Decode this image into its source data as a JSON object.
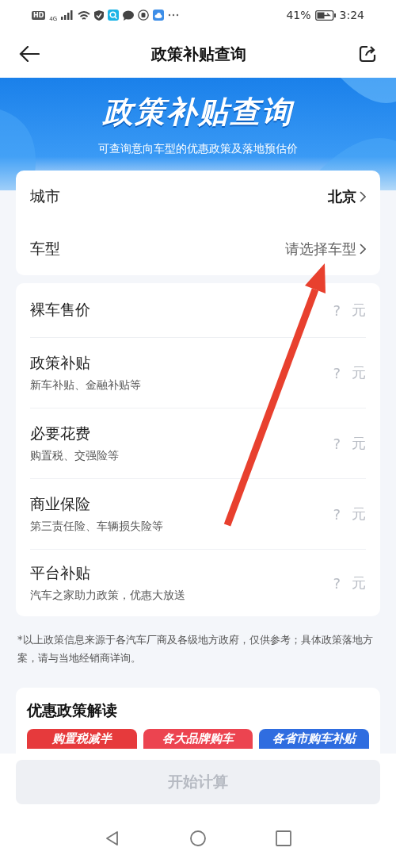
{
  "status_bar": {
    "badges": [
      "HD",
      "4G"
    ],
    "battery": "41%",
    "time": "3:24"
  },
  "nav": {
    "title": "政策补贴查询"
  },
  "banner": {
    "title": "政策补贴查询",
    "subtitle": "可查询意向车型的优惠政策及落地预估价"
  },
  "selectors": [
    {
      "label": "城市",
      "value": "北京",
      "kind": "value"
    },
    {
      "label": "车型",
      "value": "请选择车型",
      "kind": "placeholder"
    }
  ],
  "costs": [
    {
      "name": "裸车售价",
      "amount": "?",
      "unit": "元"
    },
    {
      "name": "政策补贴",
      "note": "新车补贴、金融补贴等",
      "amount": "?",
      "unit": "元"
    },
    {
      "name": "必要花费",
      "note": "购置税、交强险等",
      "amount": "?",
      "unit": "元"
    },
    {
      "name": "商业保险",
      "note": "第三责任险、车辆损失险等",
      "amount": "?",
      "unit": "元"
    },
    {
      "name": "平台补贴",
      "note": "汽车之家助力政策，优惠大放送",
      "amount": "?",
      "unit": "元"
    }
  ],
  "disclaimer": "*以上政策信息来源于各汽车厂商及各级地方政府，仅供参考；具体政策落地方案，请与当地经销商详询。",
  "policy_section": {
    "title": "优惠政策解读",
    "cards": [
      {
        "label": "购置税减半",
        "color": "#e63a3c"
      },
      {
        "label": "各大品牌购车",
        "color": "#ec4450"
      },
      {
        "label": "各省市购车补贴",
        "color": "#2f6de0"
      }
    ]
  },
  "action_button": {
    "label": "开始计算",
    "disabled": true
  }
}
